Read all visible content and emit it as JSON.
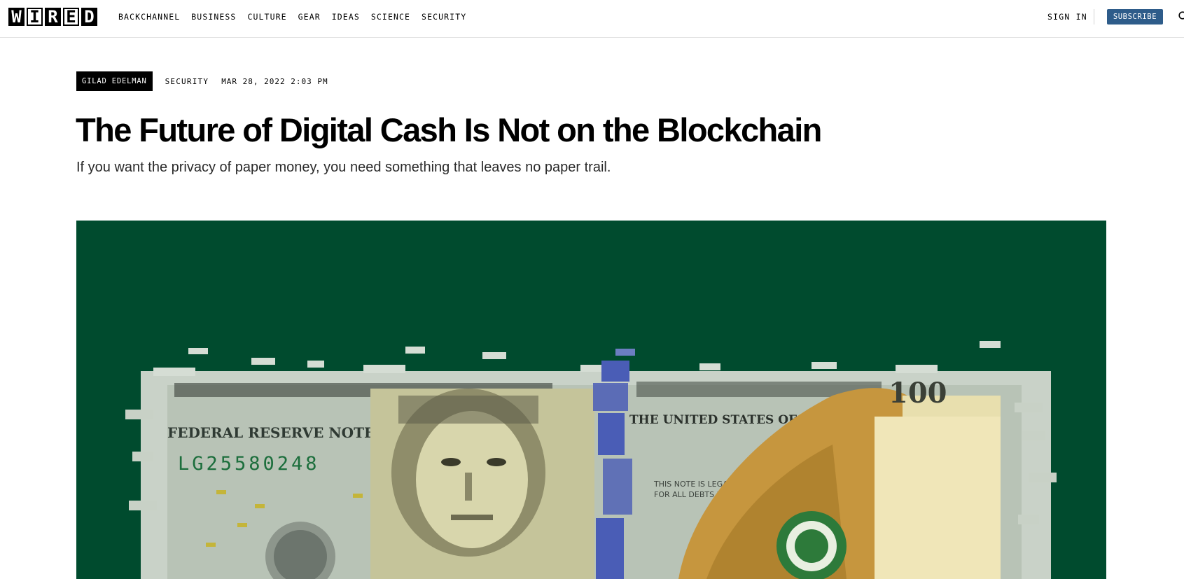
{
  "header": {
    "logo_letters": [
      "W",
      "I",
      "R",
      "E",
      "D"
    ],
    "nav": [
      "BACKCHANNEL",
      "BUSINESS",
      "CULTURE",
      "GEAR",
      "IDEAS",
      "SCIENCE",
      "SECURITY"
    ],
    "sign_in_label": "SIGN IN",
    "subscribe_label": "SUBSCRIBE",
    "subscribe_color": "#2e5c8a"
  },
  "article": {
    "author": "GILAD EDELMAN",
    "rubric": "SECURITY",
    "date": "MAR 28, 2022 2:03 PM",
    "headline": "The Future of Digital Cash Is Not on the Blockchain",
    "dek": "If you want the privacy of paper money, you need something that leaves no paper trail.",
    "hero_background": "#004b2e"
  },
  "hero_image": {
    "bill_serial": "LG25580248",
    "bill_heading": "FEDERAL RESERVE NOTE",
    "bill_text_1": "THIS NOTE IS LEGAL TENDER",
    "bill_text_2": "FOR ALL DEBTS PUBLIC AND PRIVATE",
    "bill_country": "THE UNITED STATES OF AMERICA",
    "bill_denomination": "100",
    "icons": [
      "search-icon"
    ]
  }
}
